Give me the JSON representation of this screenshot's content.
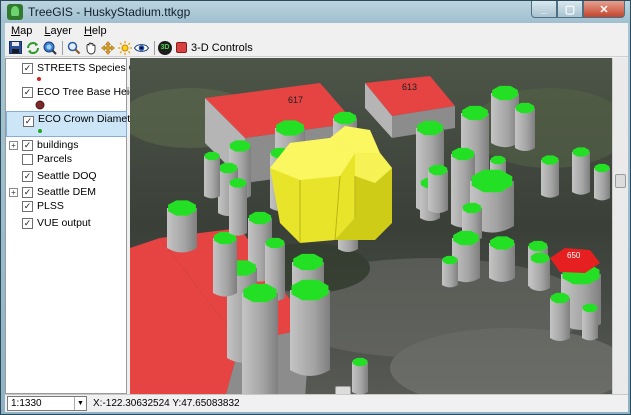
{
  "window": {
    "title": "TreeGIS - HuskyStadium.ttkgp"
  },
  "menu": {
    "items": [
      {
        "pre": "",
        "ul": "M",
        "post": "ap"
      },
      {
        "pre": "",
        "ul": "L",
        "post": "ayer"
      },
      {
        "pre": "",
        "ul": "H",
        "post": "elp"
      }
    ]
  },
  "toolbar": {
    "icons": [
      "save-icon",
      "refresh-icon",
      "zoom-extent-icon",
      "zoom-icon",
      "pan-hand-icon",
      "move-icon",
      "sun-light-icon",
      "eye-icon"
    ],
    "three_d_badge": "3D",
    "controls_label": "3-D Controls"
  },
  "layers": [
    {
      "name": "STREETS Species Code",
      "checked": true,
      "expandable": false,
      "legend": "red-dot"
    },
    {
      "name": "ECO Tree Base Height",
      "checked": true,
      "expandable": false,
      "legend": "maroon-dot"
    },
    {
      "name": "ECO Crown Diameter",
      "checked": true,
      "expandable": false,
      "legend": "green-dot",
      "selected": true
    },
    {
      "name": "buildings",
      "checked": true,
      "expandable": true
    },
    {
      "name": "Parcels",
      "checked": false,
      "expandable": false
    },
    {
      "name": "Seattle DOQ",
      "checked": true,
      "expandable": false
    },
    {
      "name": "Seattle DEM",
      "checked": true,
      "expandable": true
    },
    {
      "name": "PLSS",
      "checked": true,
      "expandable": false
    },
    {
      "name": "VUE output",
      "checked": true,
      "expandable": false
    }
  ],
  "map_labels": {
    "building_1": "617",
    "building_2": "613",
    "tree_label": "650"
  },
  "status": {
    "scale": "1:1330",
    "coords": "X:-122.30632524 Y:47.65083832"
  },
  "colors": {
    "building": "#e64343",
    "tree_crown": "#24e024",
    "highlight": "#f2ef2a",
    "trunk": "#a8a8a8"
  }
}
